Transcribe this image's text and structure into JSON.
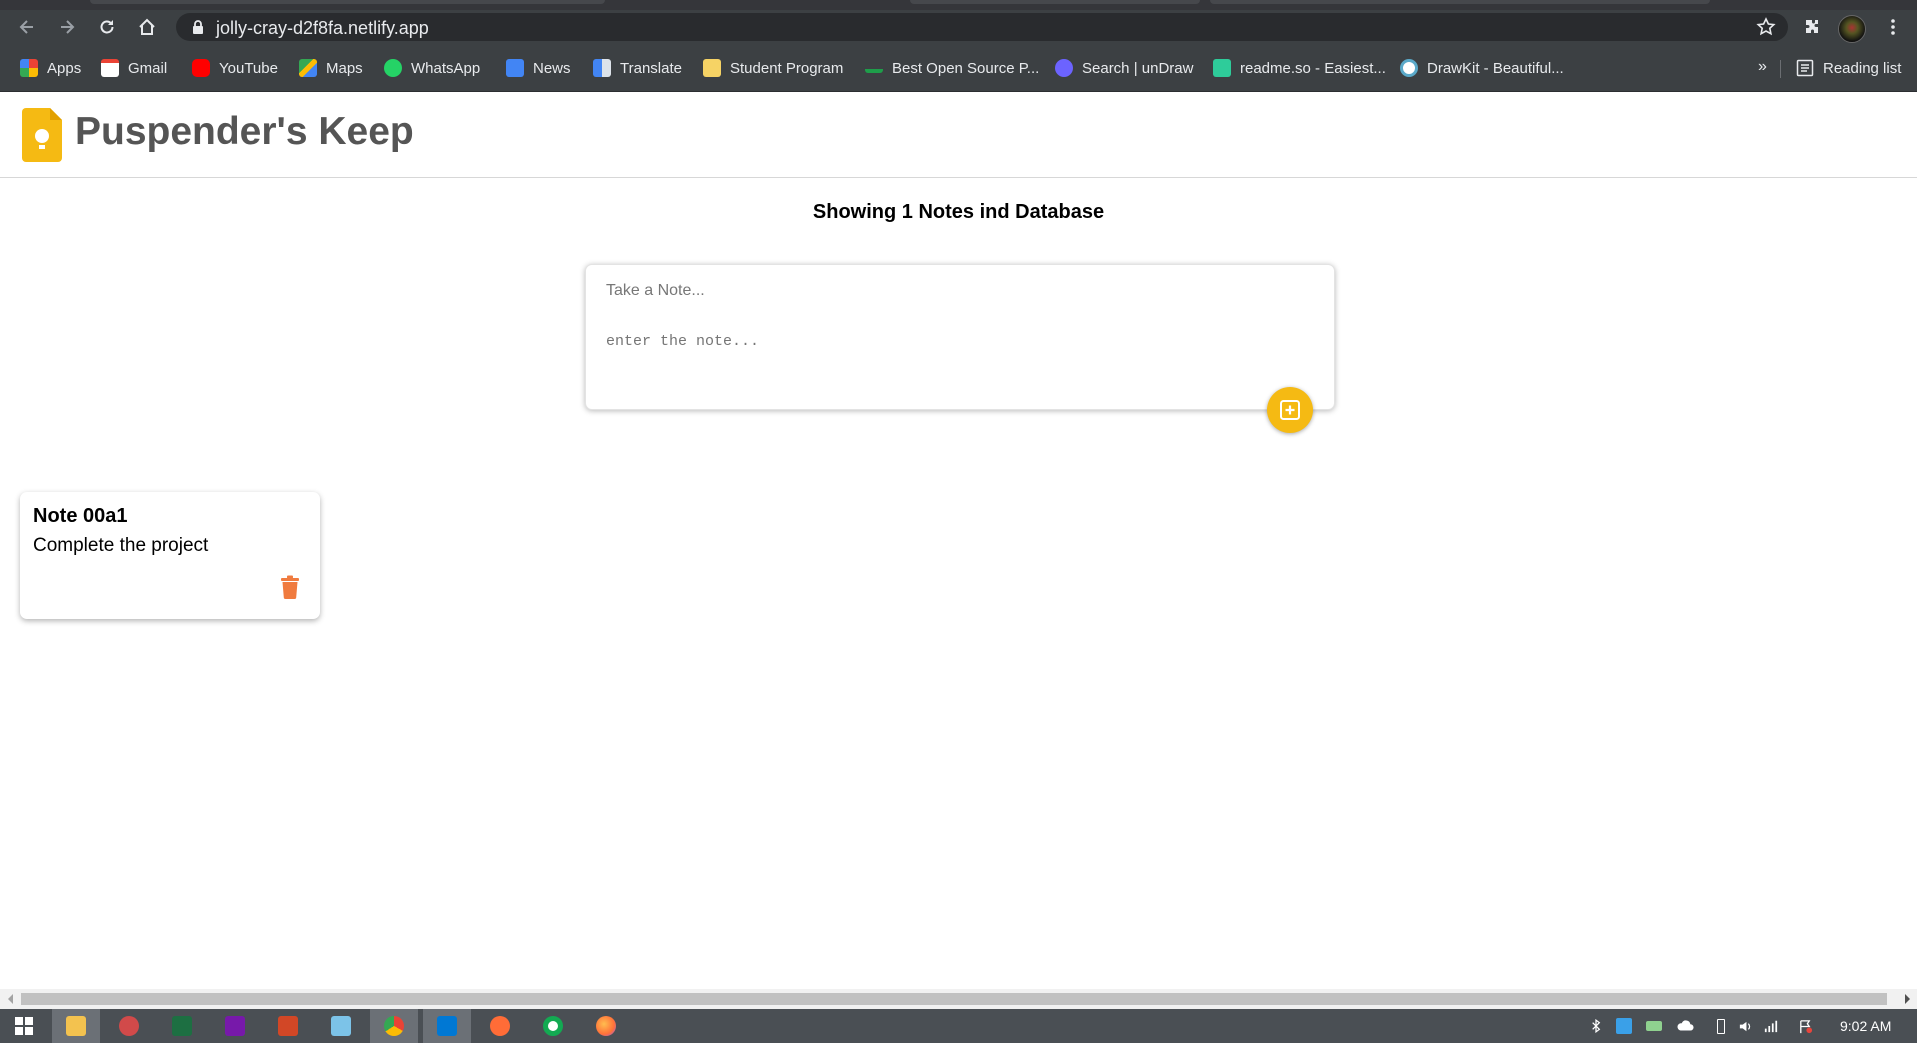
{
  "browser": {
    "url": "jolly-cray-d2f8fa.netlify.app",
    "bookmarks": [
      {
        "label": "Apps",
        "icon": "apps-grid-icon",
        "color": "#ea4335"
      },
      {
        "label": "Gmail",
        "icon": "gmail-icon",
        "color": "#ea4335"
      },
      {
        "label": "YouTube",
        "icon": "youtube-icon",
        "color": "#ff0000"
      },
      {
        "label": "Maps",
        "icon": "maps-icon",
        "color": "#34a853"
      },
      {
        "label": "WhatsApp",
        "icon": "whatsapp-icon",
        "color": "#25d366"
      },
      {
        "label": "News",
        "icon": "news-icon",
        "color": "#4285f4"
      },
      {
        "label": "Translate",
        "icon": "translate-icon",
        "color": "#4285f4"
      },
      {
        "label": "Student Program",
        "icon": "folder-icon",
        "color": "#f6d365"
      },
      {
        "label": "Best Open Source P...",
        "icon": "oss-icon",
        "color": "#1e9e4a"
      },
      {
        "label": "Search | unDraw",
        "icon": "undraw-icon",
        "color": "#6c63ff"
      },
      {
        "label": "readme.so - Easiest...",
        "icon": "readme-icon",
        "color": "#2ecc9a"
      },
      {
        "label": "DrawKit - Beautiful...",
        "icon": "drawkit-icon",
        "color": "#e8eaed"
      }
    ],
    "overflow_label": "»",
    "reading_list_label": "Reading list"
  },
  "app": {
    "title": "Puspender's Keep",
    "brand_color": "#f5ba13",
    "count_heading": "Showing 1 Notes ind Database",
    "create": {
      "title_placeholder": "Take a Note...",
      "body_placeholder": "enter the note..."
    },
    "notes": [
      {
        "title": "Note 00a1",
        "content": "Complete the project"
      }
    ],
    "delete_color": "#f07b3f"
  },
  "taskbar": {
    "apps": [
      {
        "name": "file-explorer-icon",
        "color": "#f3c24f"
      },
      {
        "name": "snipping-tool-icon",
        "color": "#d14a4a"
      },
      {
        "name": "excel-icon",
        "color": "#1d6f42"
      },
      {
        "name": "onenote-icon",
        "color": "#7719aa"
      },
      {
        "name": "powerpoint-icon",
        "color": "#d24726"
      },
      {
        "name": "notepad-icon",
        "color": "#7cc3e8"
      },
      {
        "name": "chrome-icon",
        "color": "#4285f4"
      },
      {
        "name": "vscode-icon",
        "color": "#0078d4"
      },
      {
        "name": "postman-icon",
        "color": "#ff6c37"
      },
      {
        "name": "mongodb-compass-icon",
        "color": "#13aa52"
      },
      {
        "name": "firefox-icon",
        "color": "#ff7139"
      }
    ],
    "clock": "9:02 AM"
  }
}
